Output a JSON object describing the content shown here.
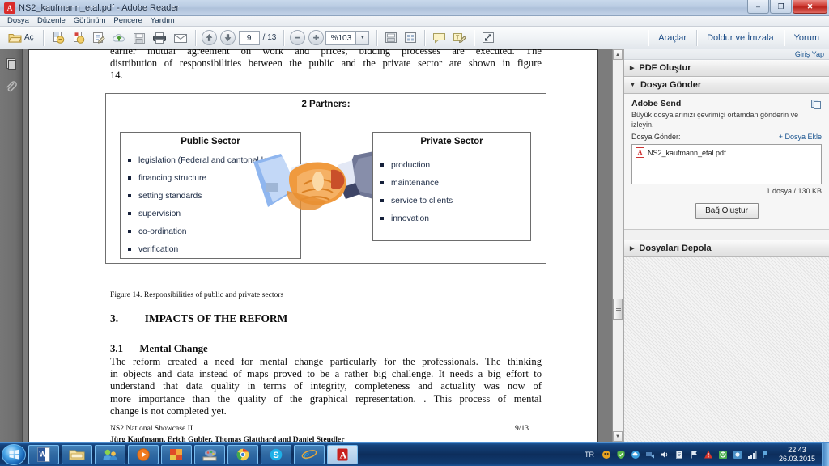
{
  "window": {
    "title": "NS2_kaufmann_etal.pdf - Adobe Reader",
    "app_icon": "pdf-icon",
    "minimize": "–",
    "maximize": "❐",
    "close": "✕"
  },
  "menubar": {
    "items": [
      {
        "label": "Dosya"
      },
      {
        "label": "Düzenle"
      },
      {
        "label": "Görünüm"
      },
      {
        "label": "Pencere"
      },
      {
        "label": "Yardım"
      }
    ]
  },
  "toolbar": {
    "open_label": "Aç",
    "page_current": "9",
    "page_total": "/ 13",
    "zoom_value": "%103",
    "right_links": [
      {
        "label": "Araçlar"
      },
      {
        "label": "Doldur ve İmzala"
      },
      {
        "label": "Yorum"
      }
    ],
    "icons": [
      "open-folder-icon",
      "create-pdf-icon",
      "export-pdf-icon",
      "edit-pdf-icon",
      "upload-cloud-icon",
      "save-icon",
      "print-icon",
      "email-icon",
      "previous-page-icon",
      "next-page-icon",
      "zoom-out-icon",
      "zoom-in-icon",
      "zoom-dropdown-icon",
      "page-fit-icon",
      "page-snapshot-icon",
      "sticky-note-icon",
      "highlight-text-icon",
      "fullscreen-icon"
    ]
  },
  "leftrail": {
    "icons": [
      {
        "name": "page-thumbnails-icon"
      },
      {
        "name": "attachments-icon"
      }
    ]
  },
  "document": {
    "intro_line1": "earlier mutual agreement on work and prices, bidding processes are executed. The",
    "intro_line2": "distribution of responsibilities between the public and the private sector are shown in figure",
    "intro_line3": "14.",
    "figure": {
      "title": "2 Partners:",
      "public": {
        "heading": "Public Sector",
        "items": [
          "legislation (Federal and cantonal level)",
          "financing structure",
          "setting standards",
          "supervision",
          "co-ordination",
          "verification"
        ]
      },
      "private": {
        "heading": "Private Sector",
        "items": [
          "production",
          "maintenance",
          "service to clients",
          "innovation"
        ]
      },
      "illustration": "handshake-illustration"
    },
    "figure_caption": "Figure 14. Responsibilities of public and private sectors",
    "heading3_num": "3.",
    "heading3_text": "IMPACTS OF THE REFORM",
    "heading31_num": "3.1",
    "heading31_text": "Mental Change",
    "body_lines": [
      "The reform created a need for mental change particularly for the professionals. The thinking",
      "in objects and data instead of maps proved to be a rather big challenge. It needs a big effort to",
      "understand that data quality in terms of integrity, completeness and actuality was now of",
      "more importance than the quality of the graphical representation. . This process of mental",
      "change is not completed yet."
    ],
    "footer_left": "NS2 National Showcase II",
    "footer_right": "9/13",
    "footer_authors": "Jürg Kaufmann, Erich Gubler, Thomas Glatthard and Daniel Steudler"
  },
  "taskpane": {
    "signin": "Giriş Yap",
    "sections": [
      {
        "title": "PDF Oluştur",
        "expanded": false,
        "caret": "▶"
      },
      {
        "title": "Dosya Gönder",
        "expanded": true,
        "caret": "▼"
      },
      {
        "title": "Dosyaları Depola",
        "expanded": false,
        "caret": "▶"
      }
    ],
    "send": {
      "brand": "Adobe Send",
      "description": "Büyük dosyalarınızı çevrimiçi ortamdan gönderin ve izleyin.",
      "field_label": "Dosya Gönder:",
      "add_link": "+ Dosya Ekle",
      "file_name": "NS2_kaufmann_etal.pdf",
      "file_icon": "pdf-file-icon",
      "copy_icon": "copy-icon",
      "stats": "1 dosya / 130 KB",
      "button": "Bağ Oluştur"
    }
  },
  "taskbar": {
    "start": "windows-start-orb",
    "items": [
      {
        "name": "word-icon",
        "glyph": "W"
      },
      {
        "name": "file-explorer-icon",
        "glyph": "📁"
      },
      {
        "name": "messenger-icon",
        "glyph": "👥"
      },
      {
        "name": "media-player-icon",
        "glyph": "▶"
      },
      {
        "name": "powerpoint-icon",
        "glyph": "P"
      },
      {
        "name": "paint-icon",
        "glyph": "🎨"
      },
      {
        "name": "chrome-icon",
        "glyph": "◉"
      },
      {
        "name": "skype-icon",
        "glyph": "S"
      },
      {
        "name": "internet-explorer-icon",
        "glyph": "e"
      },
      {
        "name": "adobe-reader-icon",
        "glyph": "A"
      }
    ],
    "language": "TR",
    "tray_icons": [
      "antivirus-icon",
      "shield-green-icon",
      "cloud-icon",
      "sync-icon",
      "volume-icon",
      "device-icon",
      "flag-icon",
      "warning-icon",
      "update-icon",
      "settings-icon",
      "network-signal-icon",
      "notification-icon"
    ],
    "clock_time": "22:43",
    "clock_date": "26.03.2015"
  }
}
